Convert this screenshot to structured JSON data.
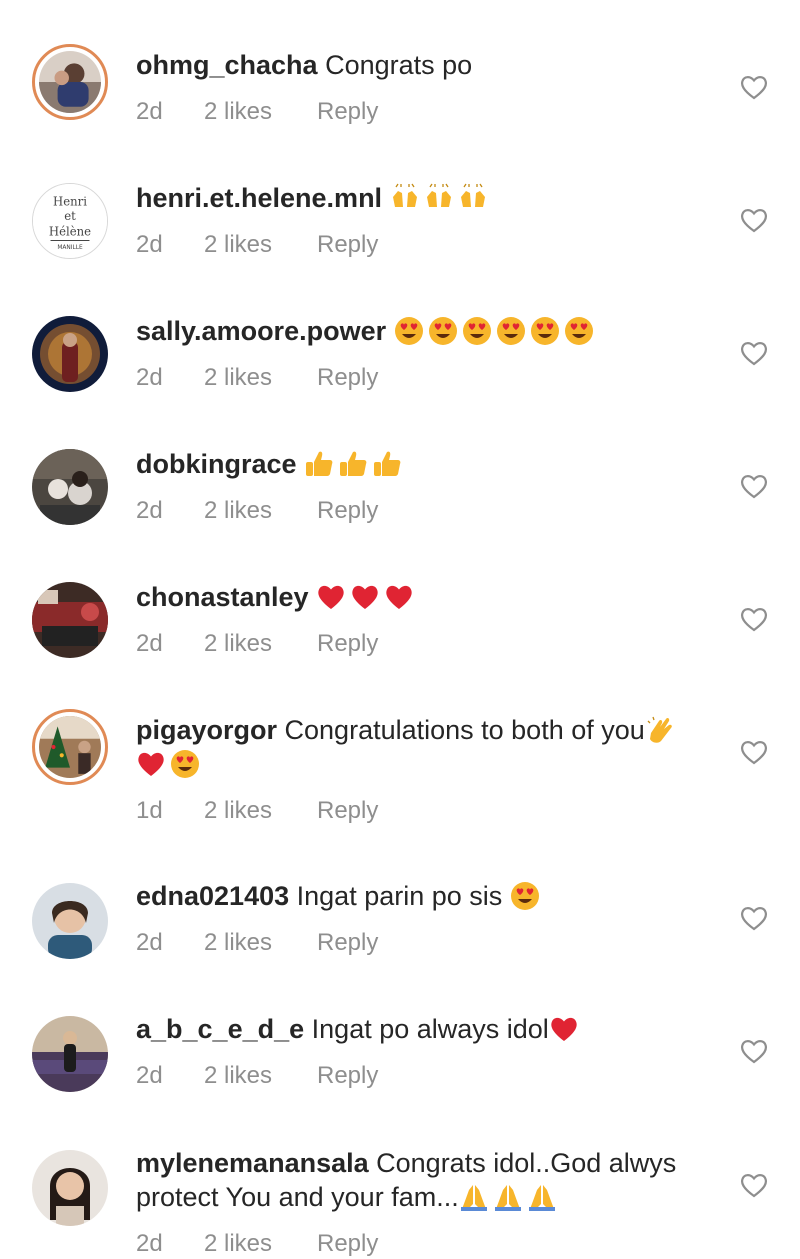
{
  "comments": [
    {
      "username": "ohmg_chacha",
      "text": "Congrats po",
      "time": "2d",
      "likes": "2 likes",
      "reply": "Reply"
    },
    {
      "username": "henri.et.helene.mnl",
      "text": "",
      "time": "2d",
      "likes": "2 likes",
      "reply": "Reply",
      "avatar_text": [
        "Henri",
        "et",
        "Hélène",
        "MANILLE"
      ]
    },
    {
      "username": "sally.amoore.power",
      "text": "",
      "time": "2d",
      "likes": "2 likes",
      "reply": "Reply"
    },
    {
      "username": "dobkingrace",
      "text": "",
      "time": "2d",
      "likes": "2 likes",
      "reply": "Reply"
    },
    {
      "username": "chonastanley",
      "text": "",
      "time": "2d",
      "likes": "2 likes",
      "reply": "Reply"
    },
    {
      "username": "pigayorgor",
      "text": "Congratulations to both of you",
      "time": "1d",
      "likes": "2 likes",
      "reply": "Reply"
    },
    {
      "username": "edna021403",
      "text": "Ingat parin po sis",
      "time": "2d",
      "likes": "2 likes",
      "reply": "Reply"
    },
    {
      "username": "a_b_c_e_d_e",
      "text": "Ingat po always idol",
      "time": "2d",
      "likes": "2 likes",
      "reply": "Reply"
    },
    {
      "username": "mylenemanansala",
      "text": "Congrats idol..God alwys protect You and your fam...",
      "time": "2d",
      "likes": "2 likes",
      "reply": "Reply"
    }
  ],
  "icons": {
    "raising_hands": "raising-hands-emoji",
    "heart_eyes": "heart-eyes-emoji",
    "thumbs_up": "thumbs-up-emoji",
    "red_heart": "red-heart-emoji",
    "clapping": "clapping-hands-emoji",
    "folded_hands": "folded-hands-emoji",
    "like": "heart-outline-icon"
  },
  "colors": {
    "username": "#262626",
    "meta": "#8e8e8e",
    "story_ring": "#e08a55",
    "emoji_yellow": "#f7b52b",
    "heart_red": "#e02433"
  }
}
